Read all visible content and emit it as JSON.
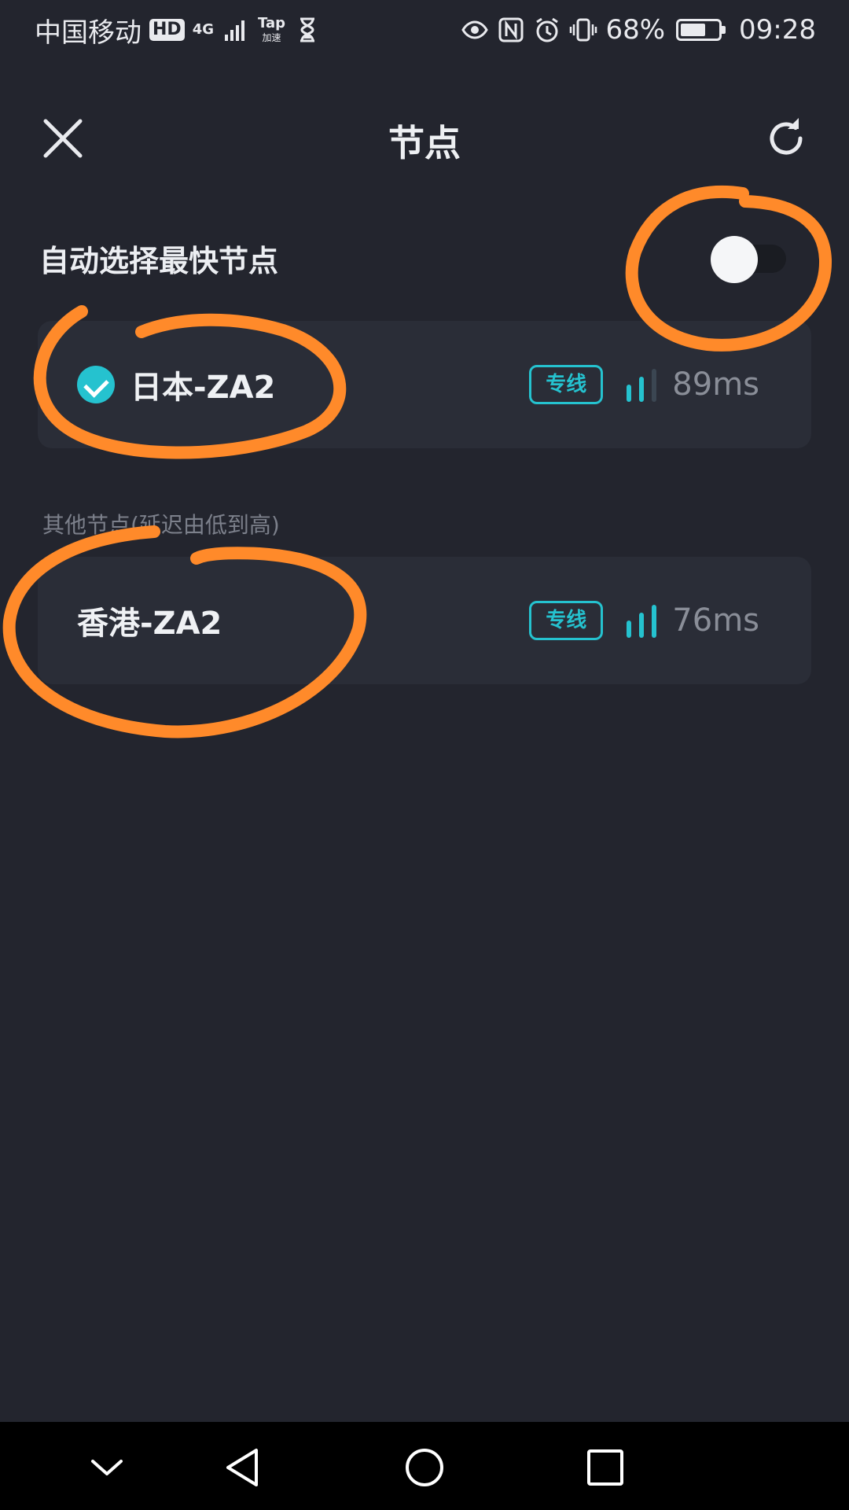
{
  "status_bar": {
    "carrier": "中国移动",
    "hd_badge": "HD",
    "network": "4G",
    "app_badge_top": "Tap",
    "app_badge_bottom": "加速",
    "battery_percent": "68%",
    "time": "09:28"
  },
  "header": {
    "title": "节点"
  },
  "auto_select": {
    "label": "自动选择最快节点",
    "enabled": false
  },
  "selected_node": {
    "name": "日本-ZA2",
    "tag": "专线",
    "latency": "89ms",
    "signal_bars": 2
  },
  "section_label": "其他节点(延迟由低到高)",
  "other_nodes": [
    {
      "name": "香港-ZA2",
      "tag": "专线",
      "latency": "76ms",
      "signal_bars": 3
    }
  ],
  "colors": {
    "background": "#23252e",
    "card": "#2a2d37",
    "accent": "#25c2cf",
    "annotation": "#ff8a2a"
  }
}
